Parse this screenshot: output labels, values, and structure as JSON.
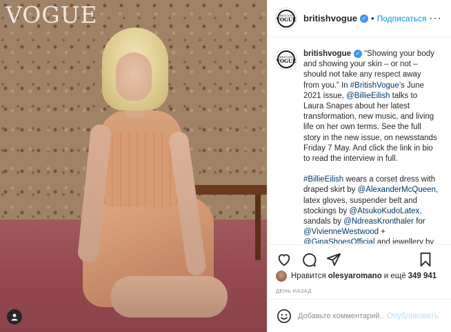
{
  "photo": {
    "logo": "VOGUE"
  },
  "header": {
    "avatar_line1": "BRITISH",
    "avatar_line2": "VOGUE",
    "username": "britishvogue",
    "separator": "•",
    "follow_label": "Подписаться",
    "more_label": "···"
  },
  "caption": {
    "username": "britishvogue",
    "para1": [
      {
        "t": "text",
        "v": "“Showing your body and showing your skin – or not – should not take any respect away from you.” In "
      },
      {
        "t": "link",
        "v": "#BritishVogue"
      },
      {
        "t": "text",
        "v": "’s June 2021 issue, "
      },
      {
        "t": "link",
        "v": "@BillieEilish"
      },
      {
        "t": "text",
        "v": " talks to Laura Snapes about her latest transformation, new music, and living life on her own terms. See the full story in the new issue, on newsstands Friday 7 May. And click the link in bio to read the interview in full."
      }
    ],
    "para2": [
      {
        "t": "link",
        "v": "#BillieEilish"
      },
      {
        "t": "text",
        "v": " wears a corset dress with draped skirt by "
      },
      {
        "t": "link",
        "v": "@AlexanderMcQueen"
      },
      {
        "t": "text",
        "v": ", latex gloves, suspender belt and stockings by "
      },
      {
        "t": "link",
        "v": "@AtsukoKudoLatex"
      },
      {
        "t": "text",
        "v": ", sandals by "
      },
      {
        "t": "link",
        "v": "@NdreasKronthaler"
      },
      {
        "t": "text",
        "v": " for "
      },
      {
        "t": "link",
        "v": "@VivienneWestwood"
      },
      {
        "t": "text",
        "v": " + "
      },
      {
        "t": "link",
        "v": "@GinaShoesOfficial"
      },
      {
        "t": "text",
        "v": " and jewellery by"
      }
    ]
  },
  "likes": {
    "prefix": "Нравится",
    "user": "olesyaromano",
    "middle": "и ещё",
    "count": "349 941"
  },
  "time": "ДЕНЬ НАЗАД",
  "comment": {
    "placeholder": "Добавьте комментарий...",
    "publish_label": "Опубликовать"
  },
  "icons": {
    "like": "heart-icon",
    "comment": "comment-icon",
    "share": "share-icon",
    "save": "bookmark-icon",
    "emoji": "smiley-icon",
    "verified": "verified-badge-icon"
  },
  "colors": {
    "link": "#00376b",
    "follow": "#0095f6",
    "publish_disabled": "#b2dffc",
    "verified": "#3897f0"
  }
}
